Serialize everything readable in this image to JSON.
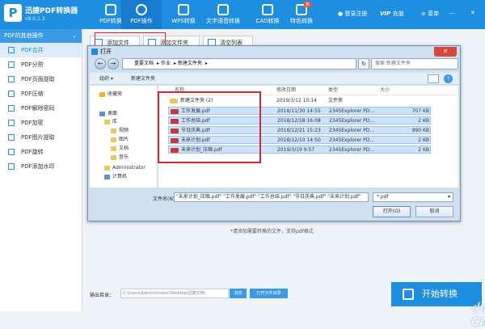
{
  "app": {
    "logo_letter": "P",
    "name": "迅捷PDF转换器",
    "version": "v8.0.1.3"
  },
  "nav": [
    {
      "id": "pdf-convert",
      "label": "PDF转换"
    },
    {
      "id": "pdf-ops",
      "label": "PDF操作"
    },
    {
      "id": "wps-convert",
      "label": "WPS转换"
    },
    {
      "id": "ocr",
      "label": "文字语音转换"
    },
    {
      "id": "cad",
      "label": "CAD转换"
    },
    {
      "id": "special",
      "label": "特色转换"
    }
  ],
  "hot_badge": "热",
  "topright": {
    "login": "登录注册",
    "vip": "VIP",
    "recharge": "充值",
    "menu": "菜单"
  },
  "sidebar": {
    "header": "PDF的其他操作",
    "items": [
      {
        "label": "PDF合并"
      },
      {
        "label": "PDF分割"
      },
      {
        "label": "PDF页面提取"
      },
      {
        "label": "PDF压缩"
      },
      {
        "label": "PDF解除密码"
      },
      {
        "label": "PDF加密"
      },
      {
        "label": "PDF图片提取"
      },
      {
        "label": "PDF旋转"
      },
      {
        "label": "PDF添加水印"
      }
    ]
  },
  "toolbar": {
    "add_file": "添加文件",
    "add_folder": "添加文件夹",
    "clear_list": "清空列表"
  },
  "hint": "*请添加需要转换的文件，支持pdf格式",
  "output": {
    "label": "输出目录：",
    "path": "C:\\Users\\Administrator\\Desktop\\迅捷文档\\",
    "browse": "浏览",
    "open_dir": "打开文件目录"
  },
  "convert_button": "开始转换",
  "watermark": "小东CAD",
  "dialog": {
    "title": "打开",
    "close": "✕",
    "breadcrumb": [
      "重要文档",
      "作业",
      "新建文件夹"
    ],
    "search_placeholder": "搜索 新建文件夹",
    "organize": "组织 ▾",
    "new_folder": "新建文件夹",
    "help": "?",
    "columns": {
      "name": "名称",
      "date": "修改日期",
      "type": "类型",
      "size": "大小"
    },
    "tree": [
      {
        "label": "收藏夹",
        "icon": "star"
      },
      {
        "label": "桌面",
        "icon": "blue"
      },
      {
        "label": "库",
        "icon": "folder"
      },
      {
        "label": "视频",
        "icon": "folder"
      },
      {
        "label": "图片",
        "icon": "folder"
      },
      {
        "label": "文档",
        "icon": "folder"
      },
      {
        "label": "音乐",
        "icon": "folder"
      },
      {
        "label": "Administrator",
        "icon": "folder"
      },
      {
        "label": "计算机",
        "icon": "blue"
      }
    ],
    "files": [
      {
        "name": "新建文件夹 (2)",
        "date": "2019/3/12 10:14",
        "type": "文件夹",
        "size": "",
        "folder": true,
        "selected": false
      },
      {
        "name": "工作发展.pdf",
        "date": "2018/11/30 14:55",
        "type": "2345Explorer PD...",
        "size": "707 KB",
        "folder": false,
        "selected": true
      },
      {
        "name": "工作总结.pdf",
        "date": "2018/12/18 16:08",
        "type": "2345Explorer PD...",
        "size": "2 KB",
        "folder": false,
        "selected": true
      },
      {
        "name": "节日庆典.pdf",
        "date": "2018/12/21 15:23",
        "type": "2345Explorer PD...",
        "size": "990 KB",
        "folder": false,
        "selected": true
      },
      {
        "name": "未来计划.pdf",
        "date": "2018/12/10 14:50",
        "type": "2345Explorer PD...",
        "size": "2 KB",
        "folder": false,
        "selected": true
      },
      {
        "name": "未来计划_压缩.pdf",
        "date": "2019/3/19 9:57",
        "type": "2345Explorer PD...",
        "size": "2 KB",
        "folder": false,
        "selected": true
      }
    ],
    "filename_label": "文件名(N):",
    "filename_value": "\"未来计划_压缩.pdf\" \"工作发展.pdf\" \"工作总结.pdf\" \"节日庆典.pdf\" \"未来计划.pdf\"",
    "filetype": "*.pdf",
    "open_button": "打开(O)",
    "cancel_button": "取消"
  }
}
